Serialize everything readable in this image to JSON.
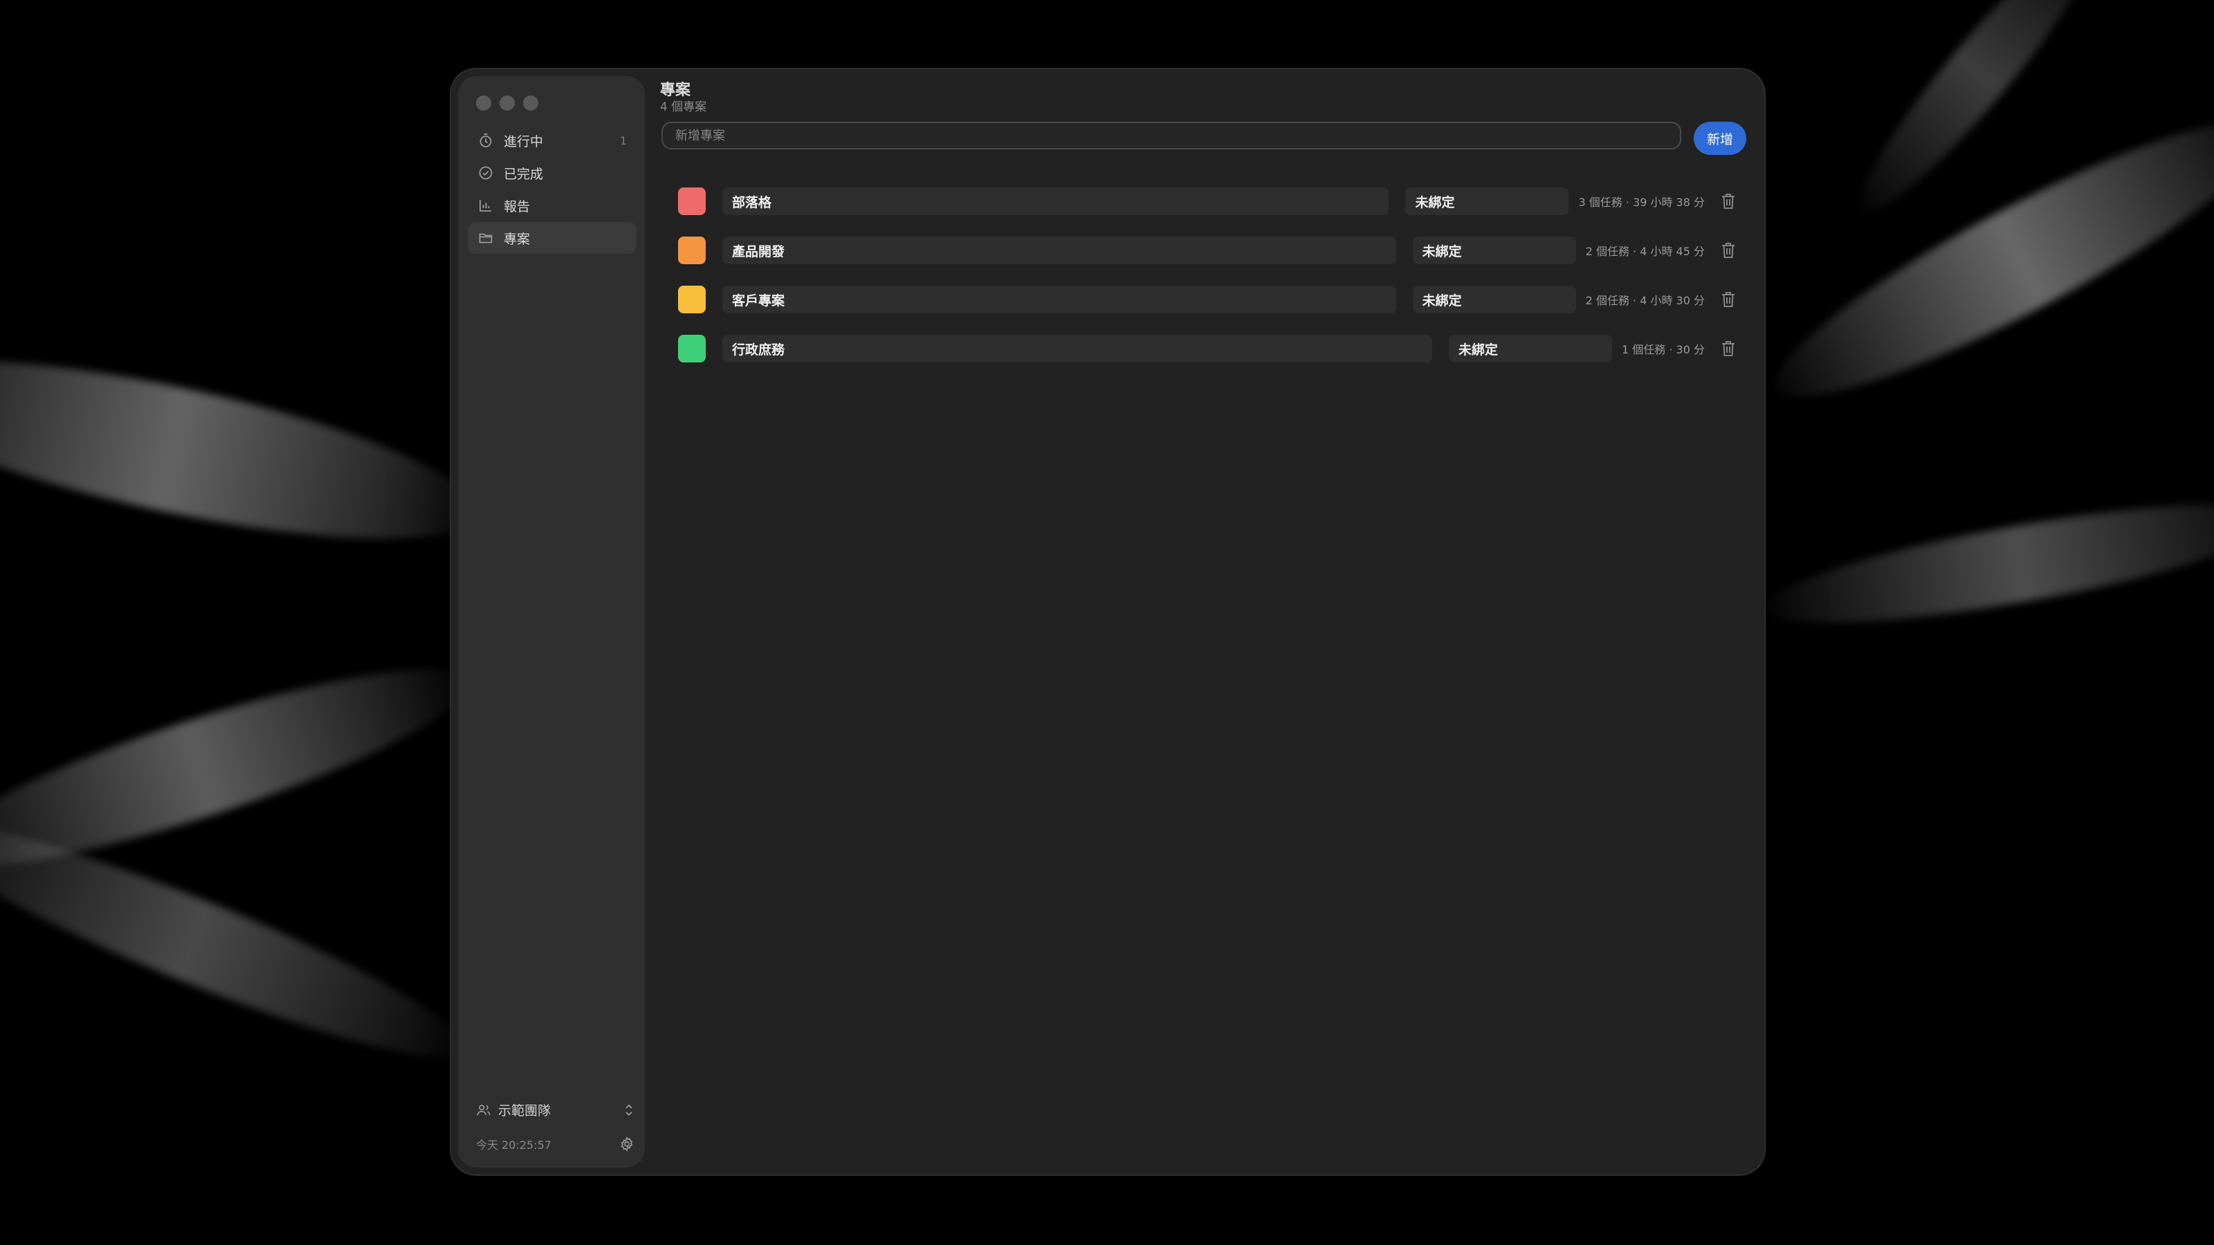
{
  "sidebar": {
    "items": [
      {
        "label": "進行中",
        "count": "1",
        "icon": "timer-icon"
      },
      {
        "label": "已完成",
        "count": "",
        "icon": "check-circle-icon"
      },
      {
        "label": "報告",
        "count": "",
        "icon": "bar-chart-icon"
      },
      {
        "label": "專案",
        "count": "",
        "icon": "folder-icon"
      }
    ],
    "team": {
      "label": "示範團隊",
      "icon": "people-icon"
    },
    "footer": {
      "time": "今天 20:25:57",
      "icon": "gear-icon"
    }
  },
  "main": {
    "title": "專案",
    "subtitle": "4 個專案",
    "new_project": {
      "placeholder": "新增專案",
      "value": ""
    },
    "add_label": "新增",
    "projects": [
      {
        "name": "部落格",
        "color": "#ef6b6b",
        "binding": "未綁定",
        "meta": "3 個任務 · 39 小時 38 分"
      },
      {
        "name": "產品開發",
        "color": "#f59540",
        "binding": "未綁定",
        "meta": "2 個任務 · 4 小時 45 分"
      },
      {
        "name": "客戶專案",
        "color": "#f8c03a",
        "binding": "未綁定",
        "meta": "2 個任務 · 4 小時 30 分"
      },
      {
        "name": "行政庶務",
        "color": "#3fd07a",
        "binding": "未綁定",
        "meta": "1 個任務 · 30 分"
      }
    ]
  },
  "colors": {
    "accent": "#2f6bd6",
    "window_bg": "#222222",
    "sidebar_bg": "#2f2f2f"
  }
}
